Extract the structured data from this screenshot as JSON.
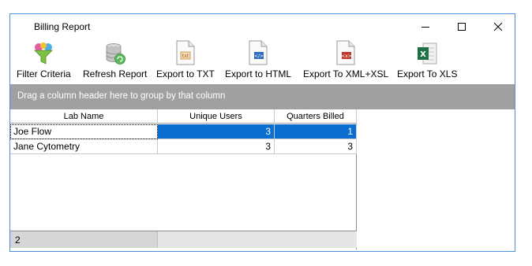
{
  "window": {
    "title": "Billing Report"
  },
  "toolbar": {
    "filter_label": "Filter Criteria",
    "refresh_label": "Refresh Report",
    "export_txt_label": "Export to TXT",
    "export_html_label": "Export to HTML",
    "export_xml_label": "Export To XML+XSL",
    "export_xls_label": "Export To XLS"
  },
  "groupbar": {
    "hint": "Drag a column header here to group by that column"
  },
  "grid": {
    "columns": [
      "Lab Name",
      "Unique Users",
      "Quarters Billed"
    ],
    "rows": [
      {
        "lab_name": "Joe Flow",
        "unique_users": "3",
        "quarters_billed": "1"
      },
      {
        "lab_name": "Jane Cytometry",
        "unique_users": "3",
        "quarters_billed": "3"
      }
    ],
    "footer_count": "2"
  },
  "colors": {
    "window_border": "#4a90d9",
    "group_bar": "#a0a0a0",
    "selection": "#0a6ed1",
    "footer": "#e6e6e6"
  },
  "icons": [
    "funnel-icon",
    "database-refresh-icon",
    "txt-file-icon",
    "html-file-icon",
    "xml-file-icon",
    "excel-file-icon",
    "minimize-icon",
    "maximize-icon",
    "close-icon"
  ]
}
